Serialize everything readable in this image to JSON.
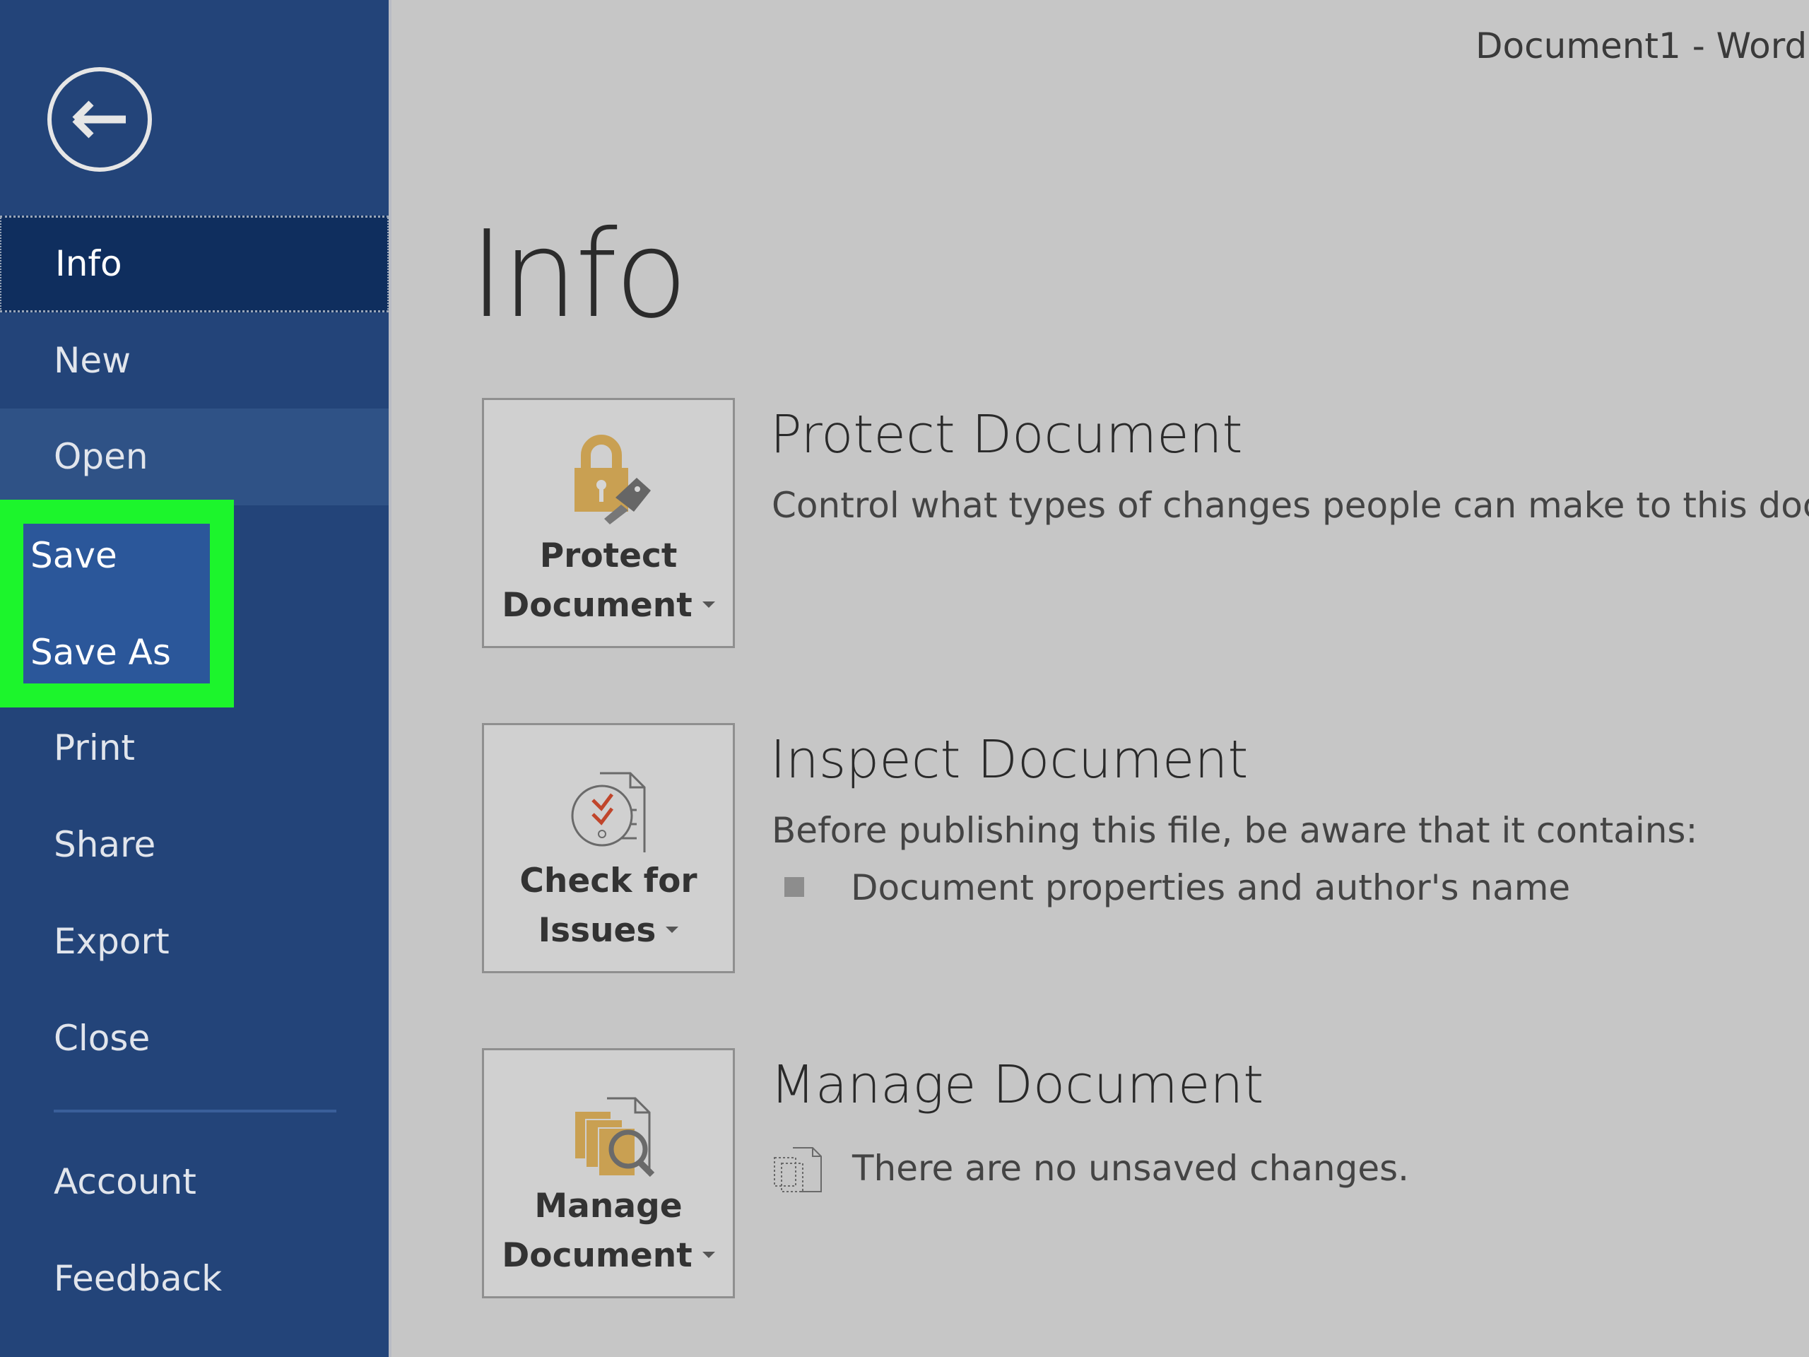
{
  "window": {
    "title": "Document1  -  Word"
  },
  "sidebar": {
    "back_label": "Back",
    "items": [
      {
        "label": "Info",
        "state": "active"
      },
      {
        "label": "New"
      },
      {
        "label": "Open",
        "state": "hover"
      },
      {
        "label": "Save",
        "state": "highlighted"
      },
      {
        "label": "Save As",
        "state": "highlighted"
      },
      {
        "label": "Print"
      },
      {
        "label": "Share"
      },
      {
        "label": "Export"
      },
      {
        "label": "Close"
      },
      {
        "label": "Account"
      },
      {
        "label": "Feedback"
      }
    ]
  },
  "main": {
    "page_title": "Info",
    "sections": [
      {
        "button_line1": "Protect",
        "button_line2": "Document",
        "icon": "lock-key-icon",
        "title": "Protect Document",
        "description": "Control what types of changes people can make to this docume"
      },
      {
        "button_line1": "Check for",
        "button_line2": "Issues",
        "icon": "checklist-document-icon",
        "title": "Inspect Document",
        "description": "Before publishing this file, be aware that it contains:",
        "bullets": [
          "Document properties and author's name"
        ]
      },
      {
        "button_line1": "Manage",
        "button_line2": "Document",
        "icon": "manage-documents-icon",
        "title": "Manage Document",
        "status_icon": "no-versions-icon",
        "description": "There are no unsaved changes."
      }
    ]
  },
  "colors": {
    "sidebar": "#234479",
    "sidebar_active": "#0f2e5e",
    "sidebar_hover": "#2f5286",
    "highlight_annotation": "#1cf52c",
    "highlight_fill": "#2b579a",
    "main_bg": "#c6c6c6",
    "icon_gold": "#c9a052",
    "icon_red": "#c0452b"
  }
}
